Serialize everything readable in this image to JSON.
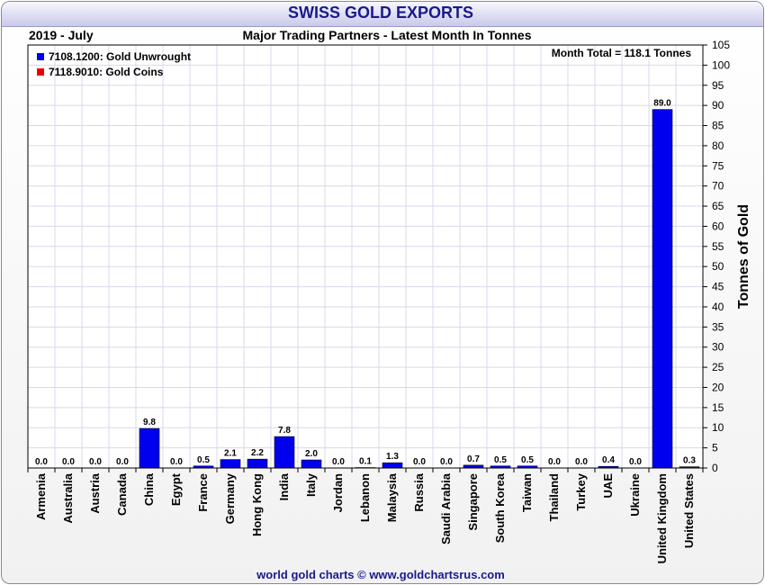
{
  "header": {
    "title": "SWISS GOLD EXPORTS",
    "date_label": "2019 - July",
    "subtitle": "Major Trading Partners - Latest Month In Tonnes",
    "footer": "world gold charts © www.goldchartsrus.com",
    "month_total": "Month Total = 118.1 Tonnes"
  },
  "colors": {
    "bar_unwrought": "#0000ee",
    "bar_coins": "#ee0000",
    "title_text": "#1a1a8c",
    "grid": "#d8d8ec"
  },
  "chart_data": {
    "type": "bar",
    "categories": [
      "Armenia",
      "Australia",
      "Austria",
      "Canada",
      "China",
      "Egypt",
      "France",
      "Germany",
      "Hong Kong",
      "India",
      "Italy",
      "Jordan",
      "Lebanon",
      "Malaysia",
      "Russia",
      "Saudi Arabia",
      "Singapore",
      "South Korea",
      "Taiwan",
      "Thailand",
      "Turkey",
      "UAE",
      "Ukraine",
      "United Kingdom",
      "United States"
    ],
    "series": [
      {
        "name": "7108.1200: Gold Unwrought",
        "color": "#0000ee",
        "values": [
          0.0,
          0.0,
          0.0,
          0.0,
          9.8,
          0.0,
          0.5,
          2.1,
          2.2,
          7.8,
          2.0,
          0.0,
          0.1,
          1.3,
          0.0,
          0.0,
          0.7,
          0.5,
          0.5,
          0.0,
          0.0,
          0.4,
          0.0,
          89.0,
          0.3
        ]
      },
      {
        "name": "7118.9010: Gold Coins",
        "color": "#ee0000",
        "values": [
          0,
          0,
          0,
          0,
          0,
          0,
          0,
          0,
          0,
          0,
          0,
          0,
          0,
          0,
          0,
          0,
          0,
          0,
          0,
          0,
          0,
          0,
          0,
          0,
          0
        ]
      }
    ],
    "data_labels": [
      "0.0",
      "0.0",
      "0.0",
      "0.0",
      "9.8",
      "0.0",
      "0.5",
      "2.1",
      "2.2",
      "7.8",
      "2.0",
      "0.0",
      "0.1",
      "1.3",
      "0.0",
      "0.0",
      "0.7",
      "0.5",
      "0.5",
      "0.0",
      "0.0",
      "0.4",
      "0.0",
      "89.0",
      "0.3"
    ],
    "ylabel": "Tonnes of Gold",
    "ylim": [
      0,
      105
    ],
    "ytick_step": 5,
    "grid": true,
    "legend_position": "top-left",
    "y_axis_side": "right"
  }
}
